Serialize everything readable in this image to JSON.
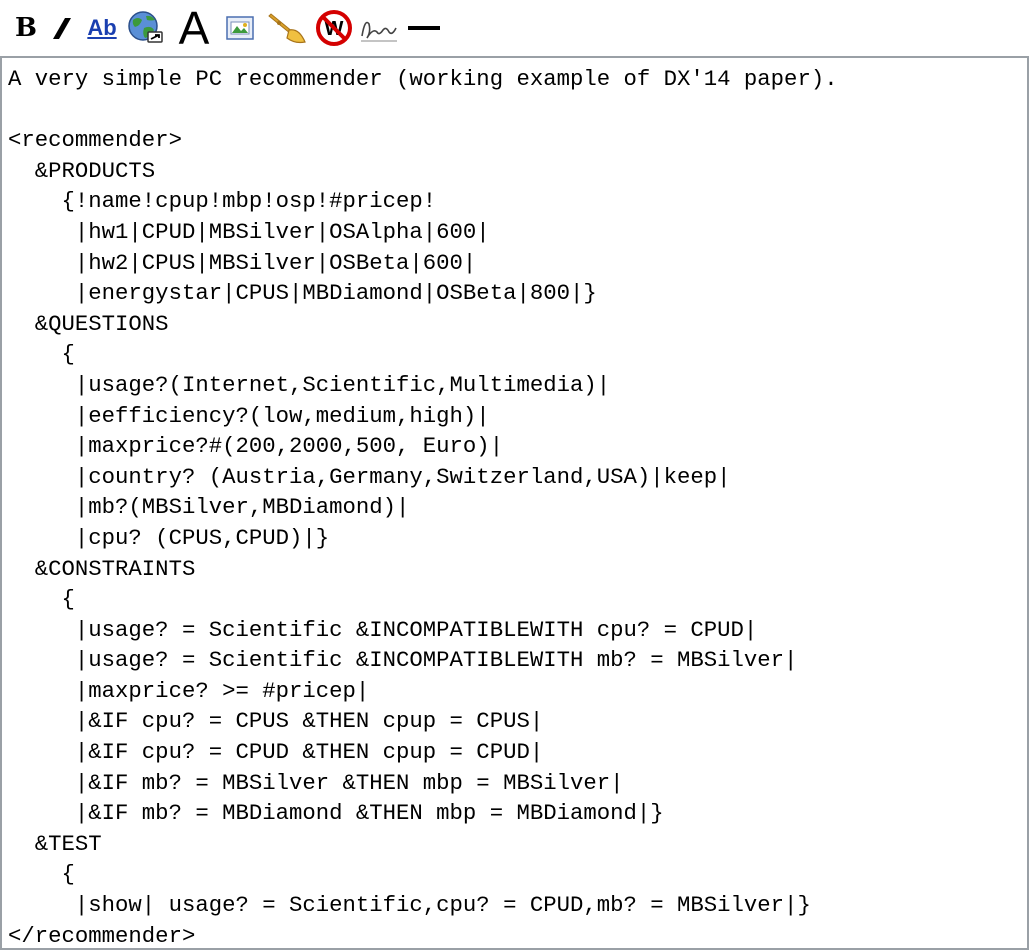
{
  "toolbar": {
    "buttons": [
      {
        "name": "bold-button",
        "icon": "bold-icon",
        "label": "B",
        "tooltip": "Bold text"
      },
      {
        "name": "italic-button",
        "icon": "italic-icon",
        "tooltip": "Italic text"
      },
      {
        "name": "internal-link-button",
        "icon": "internal-link-icon",
        "label": "Ab",
        "tooltip": "Internal link"
      },
      {
        "name": "external-link-button",
        "icon": "globe-link-icon",
        "tooltip": "External link"
      },
      {
        "name": "headline-button",
        "icon": "headline-icon",
        "label": "A",
        "tooltip": "Level 2 headline"
      },
      {
        "name": "embedded-file-button",
        "icon": "image-icon",
        "tooltip": "Embedded file"
      },
      {
        "name": "file-link-button",
        "icon": "media-file-icon",
        "tooltip": "File link"
      },
      {
        "name": "nowiki-button",
        "icon": "no-wiki-icon",
        "tooltip": "Ignore wiki formatting"
      },
      {
        "name": "signature-button",
        "icon": "signature-icon",
        "tooltip": "Your signature with timestamp"
      },
      {
        "name": "horizontal-line-button",
        "icon": "horizontal-rule-icon",
        "tooltip": "Horizontal line"
      }
    ],
    "colors": {
      "link_blue": "#1a3fb0",
      "globe_green": "#3c9a3c",
      "no_red": "#d40000",
      "trumpet_gold": "#d9a12b"
    }
  },
  "editor": {
    "lines": [
      "A very simple PC recommender (working example of DX'14 paper).",
      "",
      "<recommender>",
      "  &PRODUCTS",
      "    {!name!cpup!mbp!osp!#pricep!",
      "     |hw1|CPUD|MBSilver|OSAlpha|600|",
      "     |hw2|CPUS|MBSilver|OSBeta|600|",
      "     |energystar|CPUS|MBDiamond|OSBeta|800|}",
      "  &QUESTIONS",
      "    {",
      "     |usage?(Internet,Scientific,Multimedia)|",
      "     |eefficiency?(low,medium,high)|",
      "     |maxprice?#(200,2000,500, Euro)|",
      "     |country? (Austria,Germany,Switzerland,USA)|keep|",
      "     |mb?(MBSilver,MBDiamond)|",
      "     |cpu? (CPUS,CPUD)|}",
      "  &CONSTRAINTS",
      "    {",
      "     |usage? = Scientific &INCOMPATIBLEWITH cpu? = CPUD|",
      "     |usage? = Scientific &INCOMPATIBLEWITH mb? = MBSilver|",
      "     |maxprice? >= #pricep|",
      "     |&IF cpu? = CPUS &THEN cpup = CPUS|",
      "     |&IF cpu? = CPUD &THEN cpup = CPUD|",
      "     |&IF mb? = MBSilver &THEN mbp = MBSilver|",
      "     |&IF mb? = MBDiamond &THEN mbp = MBDiamond|}",
      "  &TEST",
      "    {",
      "     |show| usage? = Scientific,cpu? = CPUD,mb? = MBSilver|}",
      "</recommender>"
    ]
  }
}
